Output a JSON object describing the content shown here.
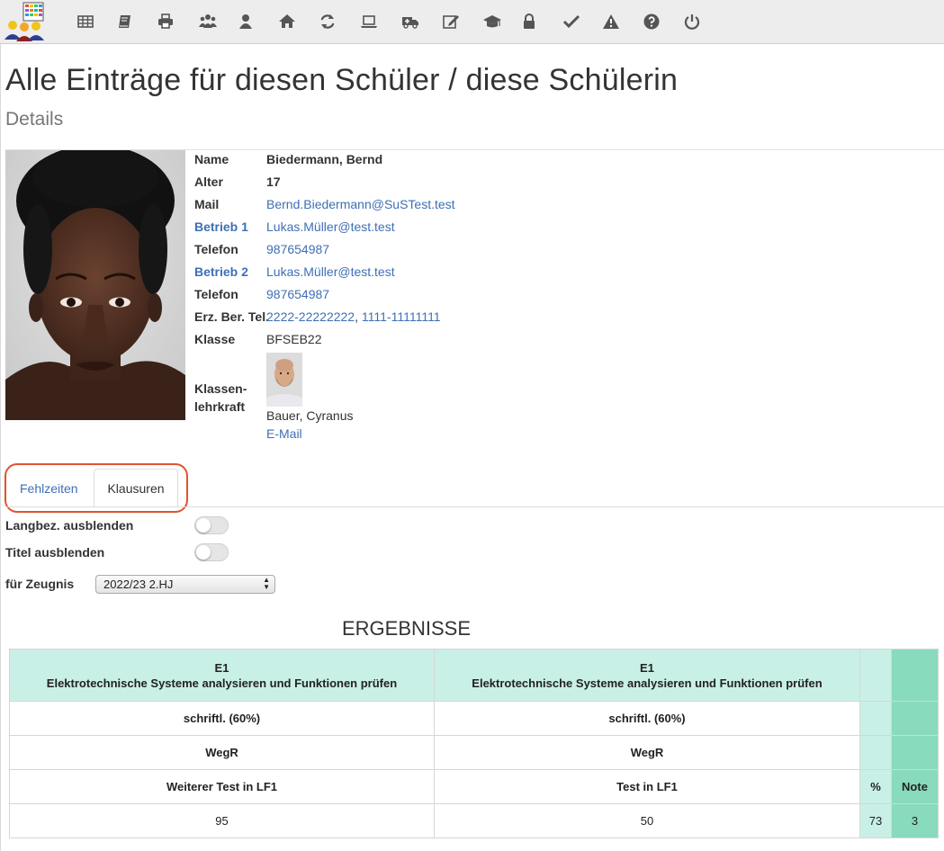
{
  "toolbar": {
    "icons": [
      "table-icon",
      "book-icon",
      "print-icon",
      "users-icon",
      "user-icon",
      "home-icon",
      "refresh-icon",
      "laptop-icon",
      "ambulance-icon",
      "edit-icon",
      "graduation-cap-icon",
      "lock-icon",
      "check-icon",
      "warning-icon",
      "help-icon",
      "power-icon"
    ]
  },
  "page": {
    "title": "Alle Einträge für diesen Schüler / diese Schülerin",
    "subtitle": "Details"
  },
  "student": {
    "name_label": "Name",
    "name": "Biedermann, Bernd",
    "age_label": "Alter",
    "age": "17",
    "mail_label": "Mail",
    "mail": "Bernd.Biedermann@SuSTest.test",
    "company1_label": "Betrieb 1",
    "company1": "Lukas.Müller@test.test",
    "phone1_label": "Telefon",
    "phone1": "987654987",
    "company2_label": "Betrieb 2",
    "company2": "Lukas.Müller@test.test",
    "phone2_label": "Telefon",
    "phone2": "987654987",
    "guardian_label": "Erz. Ber. Tel.",
    "guardian_phone_1": "2222-22222222",
    "guardian_sep": ", ",
    "guardian_phone_2": "1111-11111111",
    "class_label": "Klasse",
    "class": "BFSEB22",
    "teacher_label_1": "Klassen-",
    "teacher_label_2": "lehrkraft",
    "teacher_name": "Bauer, Cyranus",
    "teacher_mail": "E-Mail"
  },
  "tabs": {
    "absences": "Fehlzeiten",
    "exams": "Klausuren"
  },
  "options": {
    "hide_long": "Langbez. ausblenden",
    "hide_title": "Titel ausblenden",
    "report_label": "für Zeugnis",
    "report_value": "2022/23 2.HJ"
  },
  "results": {
    "heading": "ERGEBNISSE",
    "columns": [
      {
        "code": "E1",
        "subject": "Elektrotechnische Systeme analysieren und Funktionen prüfen",
        "type": "schriftl. (60%)",
        "category": "WegR",
        "test": "Weiterer Test in LF1",
        "score": "95"
      },
      {
        "code": "E1",
        "subject": "Elektrotechnische Systeme analysieren und Funktionen prüfen",
        "type": "schriftl. (60%)",
        "category": "WegR",
        "test": "Test in LF1",
        "score": "50"
      }
    ],
    "pct_header": "%",
    "note_header": "Note",
    "pct_value": "73",
    "note_value": "3"
  },
  "colors": {
    "accent": "#3f6fb5",
    "highlight": "#e0532f",
    "table_head": "#c9f0e6",
    "table_note": "#88dbbd"
  }
}
